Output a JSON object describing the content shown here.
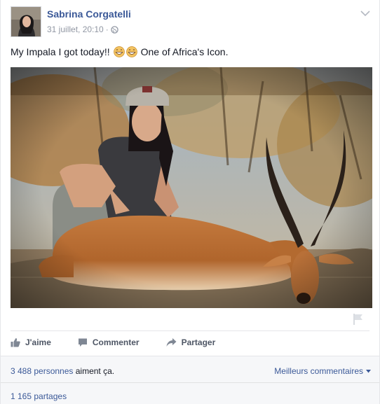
{
  "post": {
    "author": "Sabrina Corgatelli",
    "timestamp": "31 juillet, 20:10",
    "separator": "·",
    "privacy_icon": "globe-icon",
    "text_before": "My Impala I got today!!",
    "emojis": [
      "grinning-face-icon",
      "grinning-face-icon"
    ],
    "text_after": "One of Africa's Icon."
  },
  "actions": {
    "like_label": "J'aime",
    "comment_label": "Commenter",
    "share_label": "Partager"
  },
  "footer": {
    "likes_count": "3 488 personnes",
    "likes_suffix": " aiment ça.",
    "sort_label": "Meilleurs commentaires",
    "shares": "1 165 partages"
  },
  "colors": {
    "link": "#3b5998",
    "secondary": "#9197a3",
    "action_text": "#4e5665",
    "footer_bg": "#f6f7f9"
  }
}
